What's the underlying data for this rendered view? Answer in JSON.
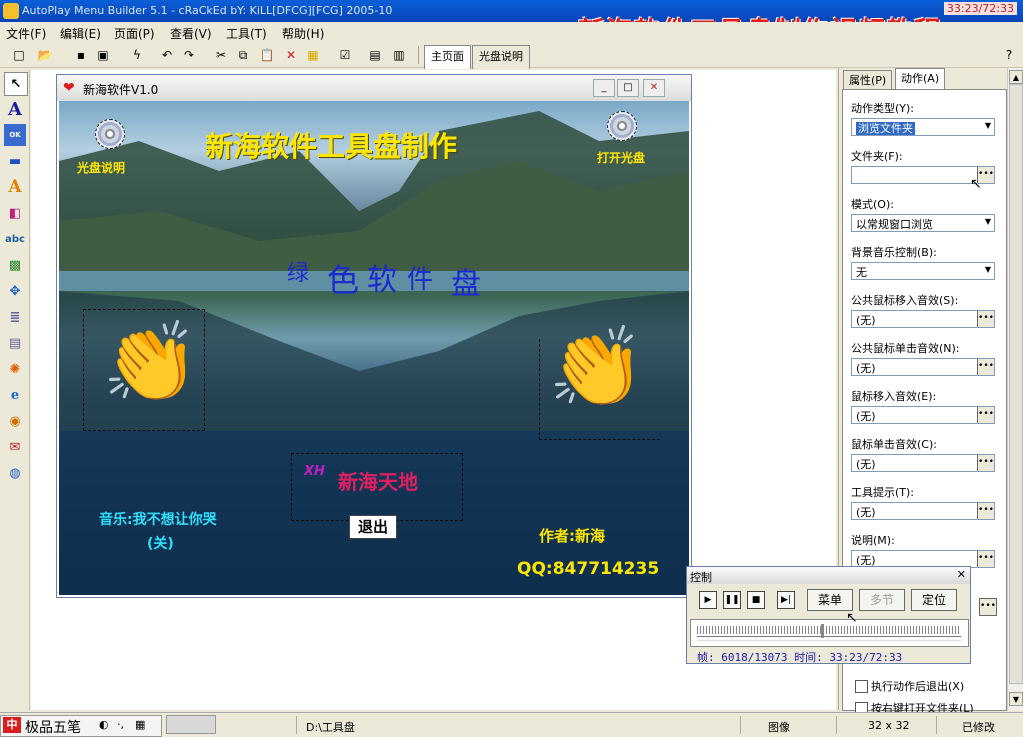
{
  "window": {
    "title": "AutoPlay Menu Builder 5.1 - cRaCkEd bY: KiLL[DFCG][FCG] 2005-10",
    "clock": "33:23/72:33"
  },
  "banner": "新海软件工具盘制作视频教程",
  "menubar": [
    "文件(F)",
    "编辑(E)",
    "页面(P)",
    "查看(V)",
    "工具(T)",
    "帮助(H)"
  ],
  "page_tabs": [
    "主页面",
    "光盘说明"
  ],
  "design_window": {
    "title": "新海软件V1.0",
    "heading": "新海软件工具盘制作",
    "disc_left_label": "光盘说明",
    "disc_right_label": "打开光盘",
    "watermark_chars": [
      "绿",
      "色",
      "软",
      "件",
      "盘"
    ],
    "music_label": "音乐:我不想让你哭",
    "music_state": "(关)",
    "exit_label": "退出",
    "author": "作者:新海",
    "qq": "QQ:847714235",
    "logo_text": "新海天地"
  },
  "right_panel": {
    "tabs": [
      "属性(P)",
      "动作(A)"
    ],
    "fields": [
      {
        "label": "动作类型(Y):",
        "value": "浏览文件夹",
        "kind": "dropdown-selected"
      },
      {
        "label": "文件夹(F):",
        "value": "",
        "kind": "ellipsis"
      },
      {
        "label": "模式(O):",
        "value": "以常规窗口浏览",
        "kind": "dropdown"
      },
      {
        "label": "背景音乐控制(B):",
        "value": "无",
        "kind": "dropdown"
      },
      {
        "label": "公共鼠标移入音效(S):",
        "value": "(无)",
        "kind": "ellipsis"
      },
      {
        "label": "公共鼠标单击音效(N):",
        "value": "(无)",
        "kind": "ellipsis"
      },
      {
        "label": "鼠标移入音效(E):",
        "value": "(无)",
        "kind": "ellipsis"
      },
      {
        "label": "鼠标单击音效(C):",
        "value": "(无)",
        "kind": "ellipsis"
      },
      {
        "label": "工具提示(T):",
        "value": "(无)",
        "kind": "ellipsis"
      },
      {
        "label": "说明(M):",
        "value": "(无)",
        "kind": "ellipsis"
      }
    ],
    "checkboxes": [
      "执行动作后退出(X)",
      "按右键打开文件夹(L)"
    ]
  },
  "control_panel": {
    "title": "控制",
    "buttons": [
      "菜单",
      "多节",
      "定位"
    ],
    "status": "帧: 6018/13073 时间: 33:23/72:33"
  },
  "statusbar": {
    "ime_name": "极品五笔",
    "path": "D:\\工具盘",
    "type": "图像",
    "size": "32 x 32",
    "state": "已修改"
  }
}
